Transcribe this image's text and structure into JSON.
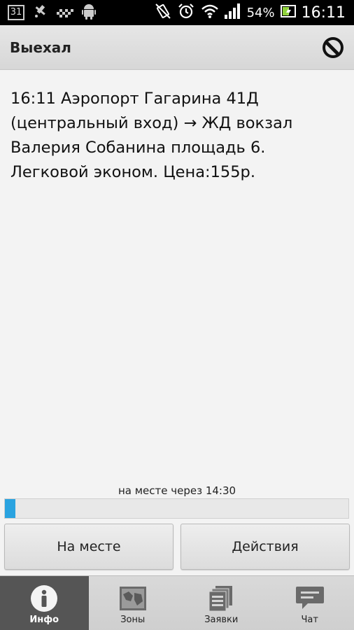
{
  "status_bar": {
    "calendar_day": "31",
    "battery_percent": "54%",
    "time": "16:11"
  },
  "action_bar": {
    "title": "Выехал",
    "menu_icon": "circle-slash-icon"
  },
  "order_info": {
    "lines": [
      "16:11 Аэропорт Гагарина 41Д",
      "(центральный вход) → ЖД вокзал",
      "Валерия Собанина площадь 6.",
      "Легковой эконом. Цена:155р."
    ]
  },
  "progress": {
    "label": "на месте через 14:30",
    "fraction": 0.03,
    "color": "#2aa3e0"
  },
  "buttons": {
    "arrived_label": "На месте",
    "actions_label": "Действия"
  },
  "tabs": [
    {
      "label": "Инфо",
      "icon": "info-icon",
      "active": true
    },
    {
      "label": "Зоны",
      "icon": "map-icon",
      "active": false
    },
    {
      "label": "Заявки",
      "icon": "orders-icon",
      "active": false
    },
    {
      "label": "Чат",
      "icon": "chat-icon",
      "active": false
    }
  ]
}
